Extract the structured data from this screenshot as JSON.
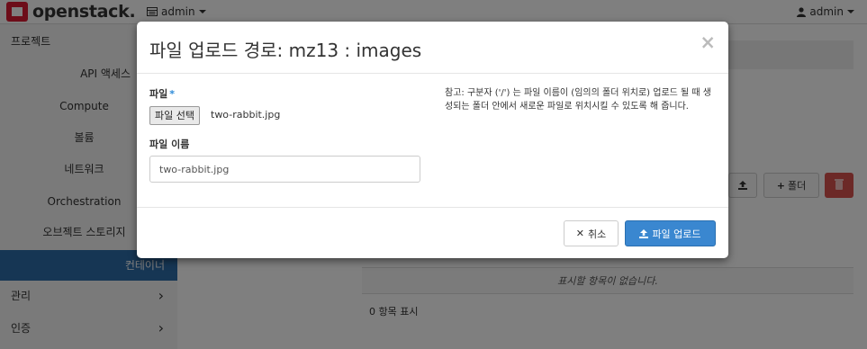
{
  "navbar": {
    "brand": "openstack.",
    "project_dropdown": "admin",
    "user_dropdown": "admin"
  },
  "sidebar": {
    "project_header": "프로젝트",
    "items": [
      {
        "label": "API 액세스"
      },
      {
        "label": "Compute"
      },
      {
        "label": "볼륨"
      },
      {
        "label": "네트워크"
      },
      {
        "label": "Orchestration"
      },
      {
        "label": "오브젝트 스토리지"
      },
      {
        "label": "컨테이너"
      }
    ],
    "admin_header": "관리",
    "identity_header": "인증"
  },
  "main": {
    "folder_button": "폴더",
    "empty_table_text": "표시할 항목이 없습니다.",
    "count_text": "0 항목 표시"
  },
  "modal": {
    "title": "파일 업로드 경로: mz13 : images",
    "close": "×",
    "file_label": "파일",
    "required_mark": "*",
    "file_button": "파일 선택",
    "file_chosen": "two-rabbit.jpg",
    "filename_label": "파일 이름",
    "filename_value": "two-rabbit.jpg",
    "help_text": "참고: 구분자 ('/') 는 파일 이름이 (임의의 폴더 위치로) 업로드 될 때 생성되는 폴더 안에서 새로운 파일로 위치시킬 수 있도록 해 줍니다.",
    "cancel_button": "취소",
    "upload_button": "파일 업로드"
  },
  "colors": {
    "brand_red": "#da1a32",
    "sidebar_active": "#2c6ca8",
    "primary_button": "#3a87d0",
    "danger_button": "#d9534f"
  }
}
